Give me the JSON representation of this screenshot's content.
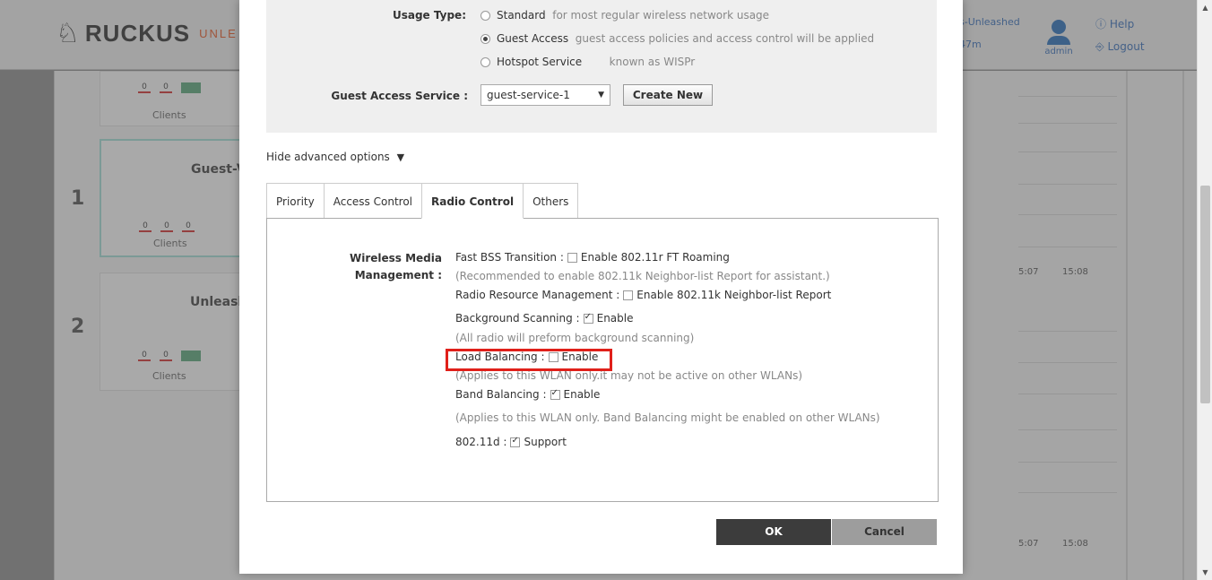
{
  "background": {
    "logo": {
      "brand": "RUCKUS",
      "sub": "UNLE"
    },
    "user_area": {
      "line1": "s-Unleashed",
      "line2": "47m"
    },
    "avatar_label": "admin",
    "links": {
      "help": "Help",
      "logout": "Logout"
    },
    "cards": [
      {
        "title": "",
        "clients": "Clients",
        "mini": [
          "0",
          "0",
          "4"
        ]
      },
      {
        "rank": "1",
        "title": "Guest-V",
        "clients": "Clients",
        "mini": [
          "0",
          "0",
          "0"
        ]
      },
      {
        "rank": "2",
        "title": "Unleash",
        "clients": "Clients",
        "mini": [
          "0",
          "0",
          "4"
        ]
      }
    ],
    "chart_ticks": {
      "a": "5:07",
      "b": "15:08"
    }
  },
  "modal": {
    "usage_type": {
      "label": "Usage Type:",
      "options": [
        {
          "label": "Standard",
          "desc": "for most regular wireless network usage",
          "checked": false
        },
        {
          "label": "Guest Access",
          "desc": "guest access policies and access control will be applied",
          "checked": true
        },
        {
          "label": "Hotspot Service",
          "desc": "known as WISPr",
          "checked": false
        }
      ]
    },
    "guest_service": {
      "label": "Guest Access Service :",
      "value": "guest-service-1",
      "create_label": "Create New"
    },
    "advanced_toggle": "Hide advanced options",
    "tabs": [
      "Priority",
      "Access Control",
      "Radio Control",
      "Others"
    ],
    "active_tab": "Radio Control",
    "radio_control": {
      "wmm_label_1": "Wireless Media",
      "wmm_label_2": "Management :",
      "fast_bss": {
        "label": "Fast BSS Transition :",
        "option": "Enable 802.11r FT Roaming",
        "checked": false
      },
      "fast_bss_note": "(Recommended to enable 802.11k Neighbor-list Report for assistant.)",
      "rrm": {
        "label": "Radio Resource Management :",
        "option": "Enable 802.11k Neighbor-list Report",
        "checked": false
      },
      "background_scanning": {
        "label": "Background Scanning :",
        "option": "Enable",
        "checked": true
      },
      "background_note": "(All radio will preform background scanning)",
      "load_balancing": {
        "label": "Load Balancing :",
        "option": "Enable",
        "checked": false
      },
      "load_note": "(Applies to this WLAN only.it may not be active on other WLANs)",
      "band_balancing": {
        "label": "Band Balancing :",
        "option": "Enable",
        "checked": true
      },
      "band_note": "(Applies to this WLAN only. Band Balancing might be enabled on other WLANs)",
      "d11": {
        "label": "802.11d :",
        "option": "Support",
        "checked": true
      }
    },
    "ok_label": "OK",
    "cancel_label": "Cancel"
  },
  "colors": {
    "highlight": "#e0201a",
    "ok_bg": "#3c3c3c",
    "cancel_bg": "#9d9d9d"
  }
}
